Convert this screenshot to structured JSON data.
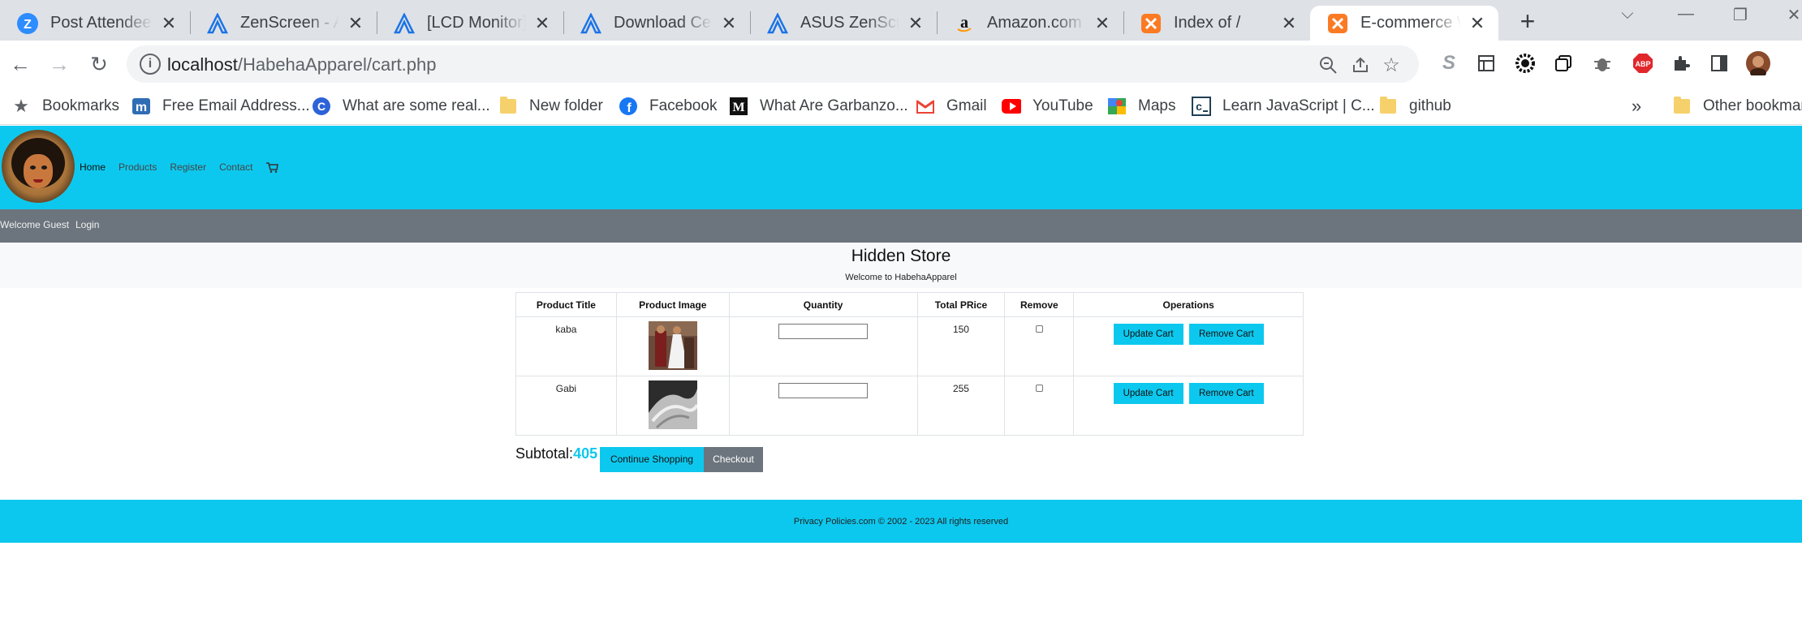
{
  "browser": {
    "tabs": [
      {
        "title": "Post Attendee - Z",
        "icon": "zoom-icon"
      },
      {
        "title": "ZenScreen - All M",
        "icon": "asus-icon"
      },
      {
        "title": "[LCD Monitor] Di",
        "icon": "asus-icon"
      },
      {
        "title": "Download Center",
        "icon": "asus-icon"
      },
      {
        "title": "ASUS ZenScreen",
        "icon": "asus-icon"
      },
      {
        "title": "Amazon.com : as",
        "icon": "amazon-icon"
      },
      {
        "title": "Index of /",
        "icon": "xampp-icon"
      },
      {
        "title": "E-commerce Web",
        "icon": "xampp-icon",
        "active": true
      }
    ],
    "url_host": "localhost",
    "url_path": "/HabehaApparel/cart.php",
    "bookmarks": [
      {
        "label": "Bookmarks",
        "icon": "star-icon"
      },
      {
        "label": "Free Email Address...",
        "icon": "mail-m-icon"
      },
      {
        "label": "What are some real...",
        "icon": "c-icon"
      },
      {
        "label": "New folder",
        "icon": "folder-icon"
      },
      {
        "label": "Facebook",
        "icon": "facebook-icon"
      },
      {
        "label": "What Are Garbanzo...",
        "icon": "medium-icon"
      },
      {
        "label": "Gmail",
        "icon": "gmail-icon"
      },
      {
        "label": "YouTube",
        "icon": "youtube-icon"
      },
      {
        "label": "Maps",
        "icon": "maps-icon"
      },
      {
        "label": "Learn JavaScript | C...",
        "icon": "codecademy-icon"
      },
      {
        "label": "github",
        "icon": "folder-icon"
      }
    ],
    "other_bookmarks": "Other bookmarks",
    "overflow": "»"
  },
  "site": {
    "nav": {
      "home": "Home",
      "products": "Products",
      "register": "Register",
      "contact": "Contact"
    },
    "welcome": "Welcome Guest",
    "login": "Login",
    "store_title": "Hidden Store",
    "store_subtitle": "Welcome to HabehaApparel",
    "table": {
      "headers": [
        "Product Title",
        "Product Image",
        "Quantity",
        "Total PRice",
        "Remove",
        "Operations"
      ],
      "rows": [
        {
          "title": "kaba",
          "price": "150"
        },
        {
          "title": "Gabi",
          "price": "255"
        }
      ],
      "update_label": "Update Cart",
      "remove_label": "Remove Cart"
    },
    "subtotal_label": "Subtotal:",
    "subtotal_value": "405",
    "continue_label": "Continue Shopping",
    "checkout_label": "Checkout",
    "footer": "Privacy Policies.com © 2002 - 2023 All rights reserved"
  },
  "colors": {
    "accent": "#0dc8ee",
    "secondary": "#6c757d"
  }
}
